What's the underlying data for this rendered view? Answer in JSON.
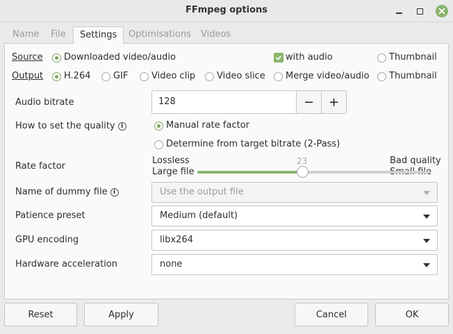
{
  "window": {
    "title": "FFmpeg options"
  },
  "tabs": [
    {
      "label": "Name"
    },
    {
      "label": "File"
    },
    {
      "label": "Settings"
    },
    {
      "label": "Optimisations"
    },
    {
      "label": "Videos"
    }
  ],
  "source": {
    "label": "Source",
    "opt_downloaded": "Downloaded video/audio",
    "with_audio": "with audio",
    "opt_thumbnail": "Thumbnail"
  },
  "output": {
    "label": "Output",
    "opt_h264": "H.264",
    "opt_gif": "GIF",
    "opt_clip": "Video clip",
    "opt_slice": "Video slice",
    "opt_merge": "Merge video/audio",
    "opt_thumbnail": "Thumbnail"
  },
  "audio_bitrate": {
    "label": "Audio bitrate",
    "value": "128",
    "minus": "−",
    "plus": "+"
  },
  "quality": {
    "label": "How to set the quality",
    "info": "i",
    "opt_manual": "Manual rate factor",
    "opt_target": "Determine from target bitrate (2-Pass)"
  },
  "rate_factor": {
    "label": "Rate factor",
    "left_top": "Lossless",
    "left_bottom": "Large file",
    "right_top": "Bad quality",
    "right_bottom": "Small file",
    "value": "23",
    "min": 0,
    "max": 51
  },
  "dummy_file": {
    "label": "Name of dummy file",
    "info": "i",
    "value": "Use the output file"
  },
  "patience": {
    "label": "Patience preset",
    "value": "Medium (default)"
  },
  "gpu": {
    "label": "GPU encoding",
    "value": "libx264"
  },
  "hwaccel": {
    "label": "Hardware acceleration",
    "value": "none"
  },
  "buttons": {
    "reset": "Reset",
    "apply": "Apply",
    "cancel": "Cancel",
    "ok": "OK"
  },
  "colors": {
    "accent": "#8ab36b",
    "close": "#8ab36b"
  }
}
